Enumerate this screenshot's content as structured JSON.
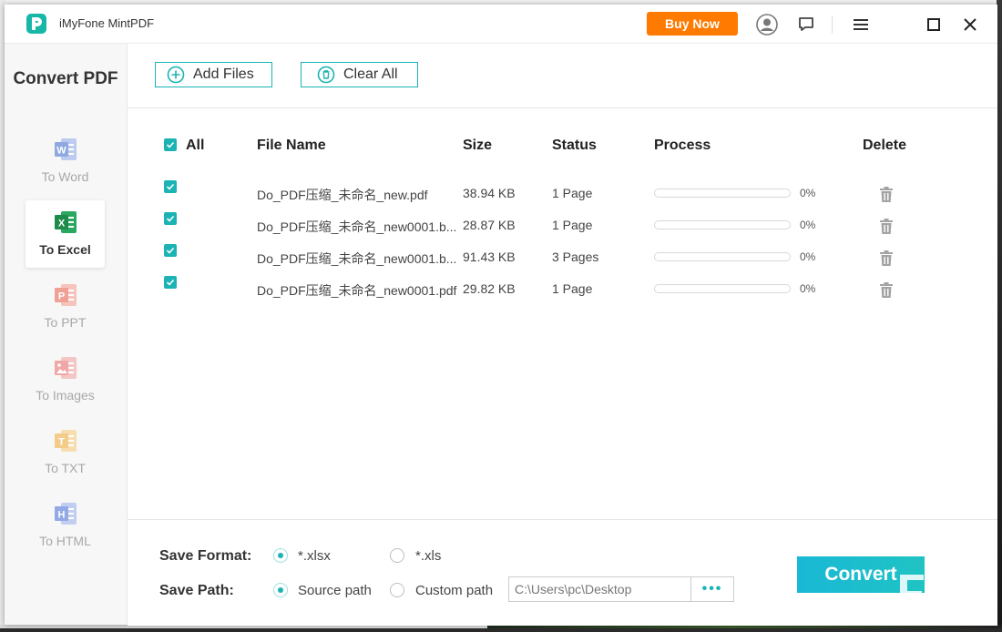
{
  "app": {
    "title": "iMyFone MintPDF",
    "buy_now_label": "Buy Now",
    "accent_color": "#1bb3b3",
    "buy_color": "#ff7a00"
  },
  "titlebar_icons": [
    "account-icon",
    "feedback-icon",
    "menu-icon",
    "maximize-icon",
    "close-icon"
  ],
  "sidebar": {
    "title": "Convert PDF",
    "active": "To Excel",
    "items": [
      {
        "label": "To Word",
        "letter": "W",
        "color": "#8fa9e0"
      },
      {
        "label": "To Excel",
        "letter": "X",
        "color": "#1f9d55"
      },
      {
        "label": "To PPT",
        "letter": "P",
        "color": "#f0a196"
      },
      {
        "label": "To Images",
        "letter": "",
        "color": "#f0a7a7"
      },
      {
        "label": "To TXT",
        "letter": "T",
        "color": "#f4cc8a"
      },
      {
        "label": "To HTML",
        "letter": "H",
        "color": "#93a9e6"
      }
    ]
  },
  "toolbar": {
    "add_files_label": "Add Files",
    "clear_all_label": "Clear All"
  },
  "table": {
    "headers": {
      "all": "All",
      "file_name": "File Name",
      "size": "Size",
      "status": "Status",
      "process": "Process",
      "delete": "Delete"
    },
    "rows": [
      {
        "name": "Do_PDF压缩_未命名_new.pdf",
        "size": "38.94 KB",
        "status": "1 Page",
        "progress": 0,
        "progress_label": "0%"
      },
      {
        "name": "Do_PDF压缩_未命名_new0001.b...",
        "size": "28.87 KB",
        "status": "1 Page",
        "progress": 0,
        "progress_label": "0%"
      },
      {
        "name": "Do_PDF压缩_未命名_new0001.b...",
        "size": "91.43 KB",
        "status": "3 Pages",
        "progress": 0,
        "progress_label": "0%"
      },
      {
        "name": "Do_PDF压缩_未命名_new0001.pdf",
        "size": "29.82 KB",
        "status": "1 Page",
        "progress": 0,
        "progress_label": "0%"
      }
    ]
  },
  "bottom": {
    "save_format_label": "Save Format:",
    "format_xlsx": "*.xlsx",
    "format_xls": "*.xls",
    "selected_format": "*.xlsx",
    "save_path_label": "Save Path:",
    "source_path_label": "Source path",
    "custom_path_label": "Custom path",
    "selected_path": "Source path",
    "path_value": "C:\\Users\\pc\\Desktop",
    "browse_label": "•••",
    "convert_label": "Convert"
  }
}
